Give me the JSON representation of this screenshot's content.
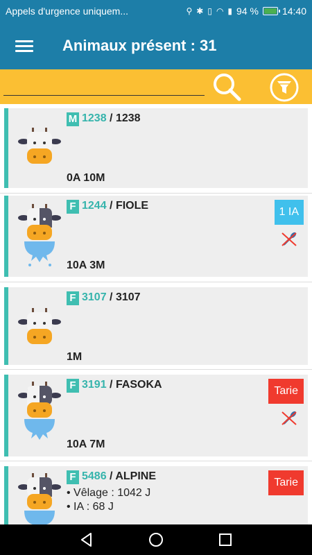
{
  "status_bar": {
    "carrier": "Appels d'urgence uniquem...",
    "battery": "94 %",
    "time": "14:40"
  },
  "app_bar": {
    "title": "Animaux présent : 31",
    "menu_icon": "hamburger-menu-icon"
  },
  "search": {
    "value": "",
    "placeholder": "",
    "search_icon": "magnifier-icon",
    "filter_icon": "funnel-filter-icon"
  },
  "animals": [
    {
      "sex": "M",
      "number": "1238",
      "name": "1238",
      "age": "0A 10M",
      "milking": false
    },
    {
      "sex": "F",
      "number": "1244",
      "name": "FIOLE",
      "age": "10A 3M",
      "milking": true,
      "status": "1 IA",
      "status_color": "#40c0ec",
      "no_insemination": true
    },
    {
      "sex": "F",
      "number": "3107",
      "name": "3107",
      "age": "1M",
      "milking": false
    },
    {
      "sex": "F",
      "number": "3191",
      "name": "FASOKA",
      "age": "10A 7M",
      "milking": true,
      "status": "Tarie",
      "status_color": "#f03a2e",
      "no_insemination": true
    },
    {
      "sex": "F",
      "number": "5486",
      "name": "ALPINE",
      "milking": true,
      "status": "Tarie",
      "status_color": "#f03a2e",
      "details": [
        "• Vêlage : 1042 J",
        "• IA : 68 J"
      ]
    }
  ],
  "separator": " / ",
  "colors": {
    "primary": "#1d7ea8",
    "search_bar": "#fbbf33",
    "accent": "#3fbeb1",
    "card_bg": "#eeeeee"
  },
  "nav": {
    "back_icon": "back-triangle-icon",
    "home_icon": "home-circle-icon",
    "recents_icon": "recents-square-icon"
  }
}
